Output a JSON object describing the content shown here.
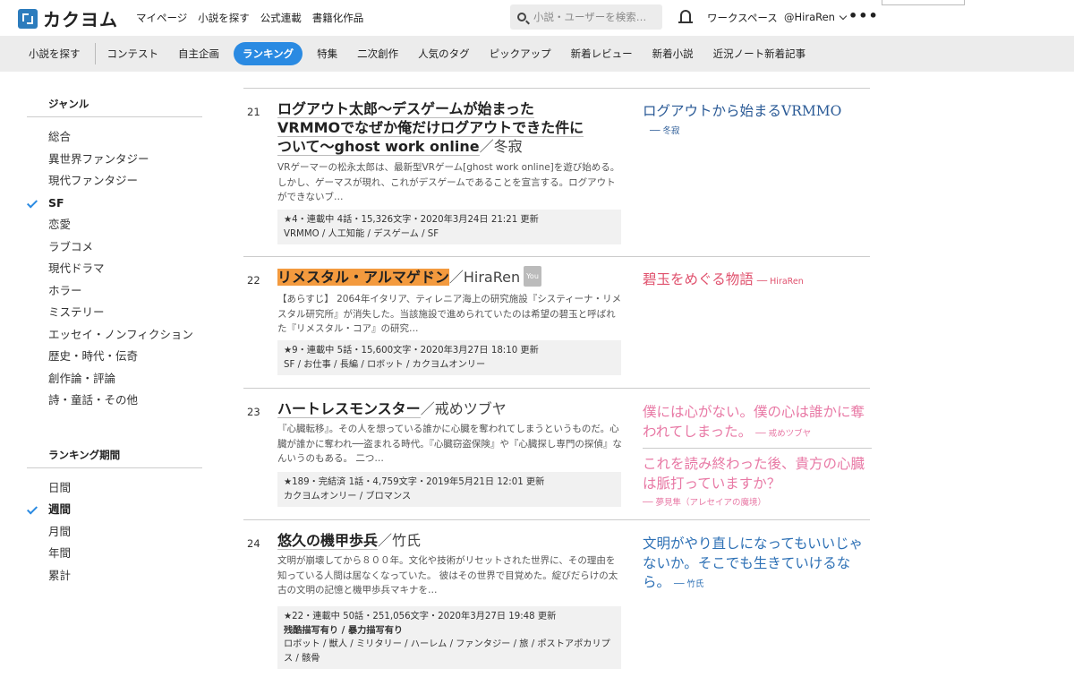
{
  "header": {
    "logo_text": "カクヨム",
    "nav": [
      "マイページ",
      "小説を探す",
      "公式連載",
      "書籍化作品"
    ],
    "search_placeholder": "小説・ユーザーを検索…",
    "workspace": "ワークスペース",
    "user": "@HiraRen",
    "more": "•••"
  },
  "subnav": {
    "first": "小説を探す",
    "items": [
      "コンテスト",
      "自主企画",
      "ランキング",
      "特集",
      "二次創作",
      "人気のタグ",
      "ピックアップ",
      "新着レビュー",
      "新着小説",
      "近況ノート新着記事"
    ],
    "active_index": 2
  },
  "sidebar": {
    "genre_title": "ジャンル",
    "genres": [
      "総合",
      "異世界ファンタジー",
      "現代ファンタジー",
      "SF",
      "恋愛",
      "ラブコメ",
      "現代ドラマ",
      "ホラー",
      "ミステリー",
      "エッセイ・ノンフィクション",
      "歴史・時代・伝奇",
      "創作論・評論",
      "詩・童話・その他"
    ],
    "genre_selected": 3,
    "period_title": "ランキング期間",
    "periods": [
      "日間",
      "週間",
      "月間",
      "年間",
      "累計"
    ],
    "period_selected": 1
  },
  "entries": [
    {
      "rank": "21",
      "title": "ログアウト太郎〜デスゲームが始まったVRMMOでなぜか俺だけログアウトできた件について〜ghost work online",
      "author": "／冬寂",
      "summary": "VRゲーマーの松永太郎は、最新型VRゲーム[ghost work online]を遊び始める。しかし、ゲーマスが現れ、これがデスゲームであることを宣言する。ログアウトができないブ…",
      "stats": "★4・連載中 4話・15,326文字・2020年3月24日 21:21 更新",
      "tags": "VRMMO / 人工知能 / デスゲーム / SF",
      "catchphrases": [
        {
          "text": "ログアウトから始まるVRMMO",
          "by": "── 冬寂",
          "color": "#2a5a96"
        }
      ]
    },
    {
      "rank": "22",
      "title": "リメスタル・アルマゲドン",
      "author": "／HiraRen",
      "you": "You",
      "summary": "【あらすじ】 2064年イタリア、ティレニア海上の研究施設『システィーナ・リメスタル研究所』が消失した。当該施設で進められていたのは希望の碧玉と呼ばれた『リメスタル・コア』の研究…",
      "stats": "★9・連載中 5話・15,600文字・2020年3月27日 18:10 更新",
      "tags": "SF / お仕事 / 長編 / ロボット / カクヨムオンリー",
      "catchphrases": [
        {
          "text": "碧玉をめぐる物語",
          "by": "── HiraRen",
          "color": "#e0526e"
        }
      ]
    },
    {
      "rank": "23",
      "title": "ハートレスモンスター",
      "author": "／戒めツブヤ",
      "summary": "『心臓転移』。その人を想っている誰かに心臓を奪われてしまうというものだ。心臓が誰かに奪われ──盗まれる時代。『心臓窃盗保険』や『心臓探し専門の探偵』なんいうのもある。 二つ…",
      "stats": "★189・完結済 1話・4,759文字・2019年5月21日 12:01 更新",
      "tags": "カクヨムオンリー / ブロマンス",
      "catchphrases": [
        {
          "text": "僕には心がない。僕の心は誰かに奪われてしまった。",
          "by": "── 戒めツブヤ",
          "color": "#e879a5"
        },
        {
          "text": "これを読み終わった後、貴方の心臓は脈打っていますか？",
          "by": "── 夢見隼（アレセイアの魔境）",
          "color": "#e879a5"
        }
      ]
    },
    {
      "rank": "24",
      "title": "悠久の機甲歩兵",
      "author": "／竹氏",
      "summary": "文明が崩壊してから８００年。文化や技術がリセットされた世界に、その理由を知っている人間は居なくなっていた。 彼はその世界で目覚めた。綻びだらけの太古の文明の記憶と機甲歩兵マキナを…",
      "stats": "★22・連載中 50話・251,056文字・2020年3月27日 19:48 更新",
      "warnings": "残酷描写有り / 暴力描写有り",
      "tags": "ロボット / 獣人 / ミリタリー / ハーレム / ファンタジー / 旅 / ポストアポカリプス / 骸骨",
      "catchphrases": [
        {
          "text": "文明がやり直しになってもいいじゃないか。そこでも生きていけるなら。",
          "by": "── 竹氏",
          "color": "#2d70b5"
        }
      ]
    }
  ]
}
